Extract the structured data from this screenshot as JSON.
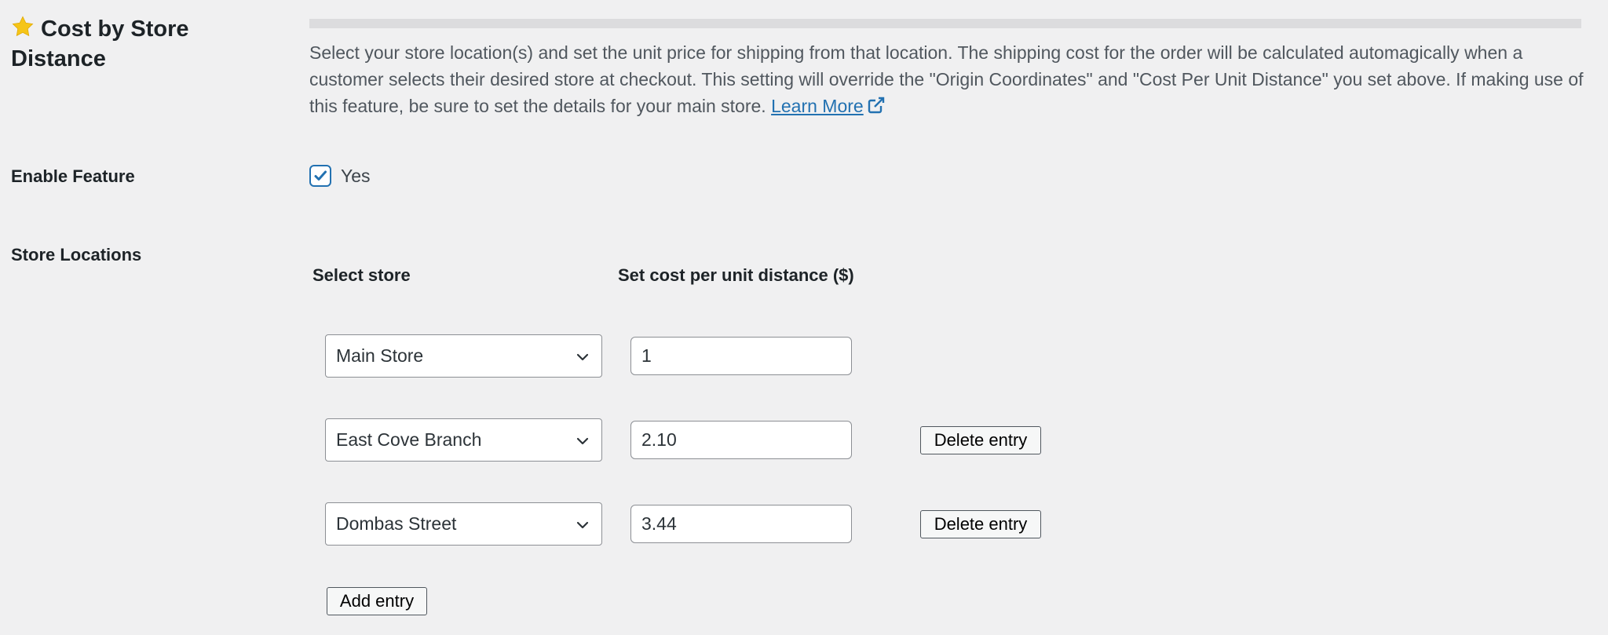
{
  "section": {
    "title": "Cost by Store Distance",
    "description": "Select your store location(s) and set the unit price for shipping from that location. The shipping cost for the order will be calculated automagically when a customer selects their desired store at checkout. This setting will override the \"Origin Coordinates\" and \"Cost Per Unit Distance\" you set above. If making use of this feature, be sure to set the details for your main store.",
    "learn_more_label": "Learn More",
    "icon": "star-icon",
    "icon_color": "#f5c518"
  },
  "enable_feature": {
    "label": "Enable Feature",
    "checkbox_label": "Yes",
    "checked": true
  },
  "store_locations": {
    "label": "Store Locations",
    "col_store_header": "Select store",
    "col_cost_header": "Set cost per unit distance ($)",
    "rows": [
      {
        "store": "Main Store",
        "cost": "1",
        "delete_label": ""
      },
      {
        "store": "East Cove Branch",
        "cost": "2.10",
        "delete_label": "Delete entry"
      },
      {
        "store": "Dombas Street",
        "cost": "3.44",
        "delete_label": "Delete entry"
      }
    ],
    "add_label": "Add entry"
  },
  "colors": {
    "accent": "#2271b1",
    "background": "#f0f0f1",
    "text_muted": "#50575e"
  }
}
